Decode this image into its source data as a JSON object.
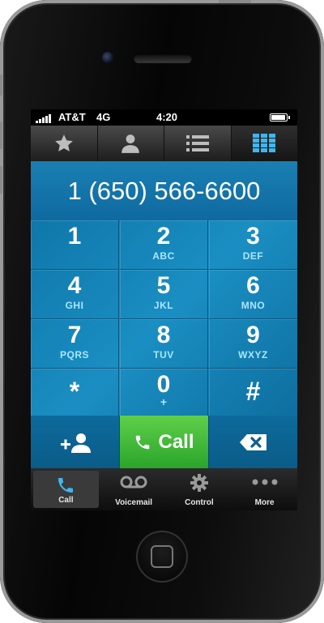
{
  "status_bar": {
    "carrier": "AT&T",
    "network": "4G",
    "time": "4:20"
  },
  "top_tabs": [
    {
      "icon": "star-icon"
    },
    {
      "icon": "contact-icon"
    },
    {
      "icon": "list-icon"
    },
    {
      "icon": "keypad-grid-icon",
      "active": true
    }
  ],
  "display": {
    "number": "1 (650) 566-6600"
  },
  "keypad": {
    "keys": [
      {
        "digit": "1",
        "letters": ""
      },
      {
        "digit": "2",
        "letters": "ABC"
      },
      {
        "digit": "3",
        "letters": "DEF"
      },
      {
        "digit": "4",
        "letters": "GHI"
      },
      {
        "digit": "5",
        "letters": "JKL"
      },
      {
        "digit": "6",
        "letters": "MNO"
      },
      {
        "digit": "7",
        "letters": "PQRS"
      },
      {
        "digit": "8",
        "letters": "TUV"
      },
      {
        "digit": "9",
        "letters": "WXYZ"
      },
      {
        "digit": "*",
        "letters": ""
      },
      {
        "digit": "0",
        "letters": "+"
      },
      {
        "digit": "#",
        "letters": ""
      }
    ]
  },
  "actions": {
    "call_label": "Call"
  },
  "bottom_tabs": [
    {
      "label": "Call",
      "icon": "phone-icon",
      "active": true
    },
    {
      "label": "Voicemail",
      "icon": "voicemail-icon"
    },
    {
      "label": "Control",
      "icon": "gear-icon"
    },
    {
      "label": "More",
      "icon": "more-dots-icon"
    }
  ],
  "colors": {
    "keypad_blue": "#1a8ec2",
    "call_green": "#2aa52a",
    "letters": "#a9e6ff"
  }
}
